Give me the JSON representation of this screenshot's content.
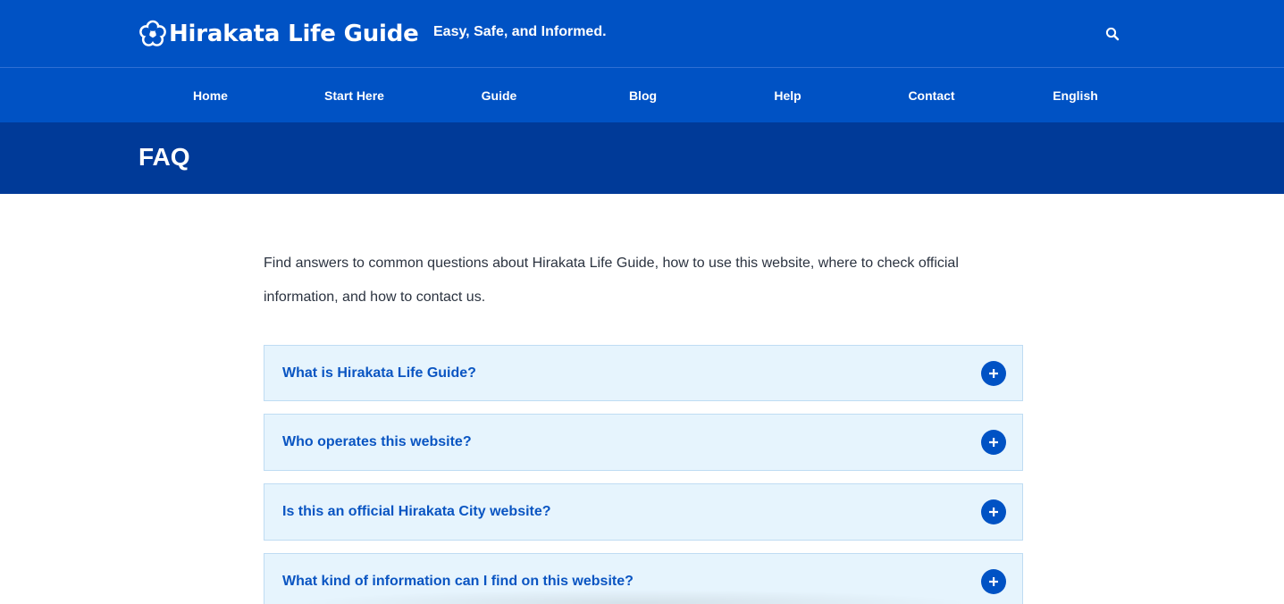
{
  "header": {
    "logo_text": "Hirakata Life Guide",
    "tagline": "Easy, Safe, and Informed.",
    "search_icon": "search-icon",
    "colors": {
      "top_bar": "#0052c4",
      "hero": "#003a98",
      "accent": "#0a55c2"
    }
  },
  "nav": {
    "items": [
      {
        "label": "Home"
      },
      {
        "label": "Start Here"
      },
      {
        "label": "Guide"
      },
      {
        "label": "Blog"
      },
      {
        "label": "Help"
      },
      {
        "label": "Contact"
      },
      {
        "label": "English"
      }
    ]
  },
  "hero": {
    "title": "FAQ"
  },
  "main": {
    "intro": "Find answers to common questions about Hirakata Life Guide, how to use this website, where to check official information, and how to contact us.",
    "faq": [
      {
        "question": "What is Hirakata Life Guide?",
        "toggle_icon": "plus-icon"
      },
      {
        "question": "Who operates this website?",
        "toggle_icon": "plus-icon"
      },
      {
        "question": "Is this an official Hirakata City website?",
        "toggle_icon": "plus-icon"
      },
      {
        "question": "What kind of information can I find on this website?",
        "toggle_icon": "plus-icon"
      }
    ]
  }
}
